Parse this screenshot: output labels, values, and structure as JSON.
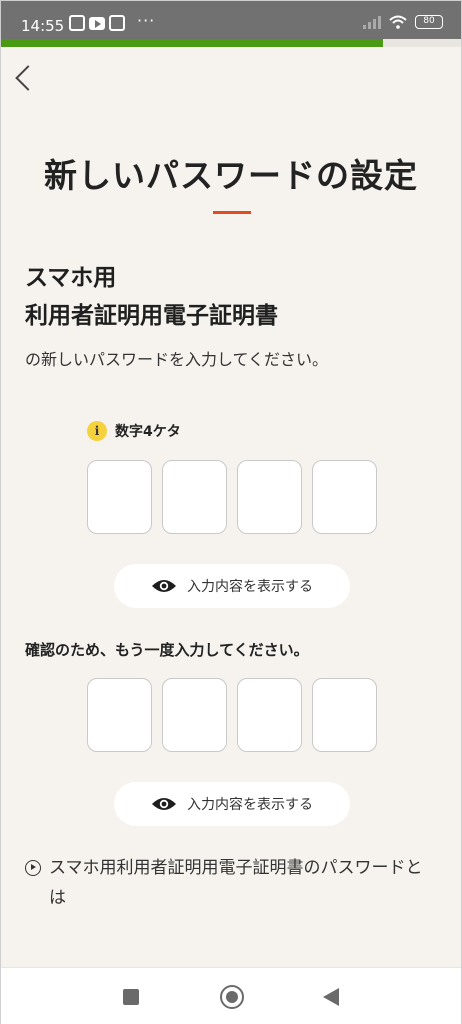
{
  "status_bar": {
    "time": "14:55",
    "more": "···",
    "battery": "80",
    "app_icons": [
      "line-icon",
      "youtube-icon",
      "paypay-icon"
    ]
  },
  "progress": {
    "fraction": 0.83,
    "color": "#4a9a13"
  },
  "header": {
    "back_label": "〈"
  },
  "page": {
    "title": "新しいパスワードの設定",
    "accent_color": "#e24a22",
    "heading_line1": "スマホ用",
    "heading_line2": "利用者証明用電子証明書",
    "subtext": "の新しいパスワードを入力してください。"
  },
  "pin_entry": {
    "hint_icon": "i",
    "hint": "数字4ケタ",
    "digits": [
      "",
      "",
      "",
      ""
    ],
    "show_toggle_label": "入力内容を表示する"
  },
  "pin_confirm": {
    "label": "確認のため、もう一度入力してください。",
    "digits": [
      "",
      "",
      "",
      ""
    ],
    "show_toggle_label": "入力内容を表示する"
  },
  "faq": {
    "link_text": "スマホ用利用者証明用電子証明書のパスワードとは"
  },
  "nav_bar": {
    "buttons": [
      "recents-button",
      "home-button",
      "back-button"
    ]
  }
}
